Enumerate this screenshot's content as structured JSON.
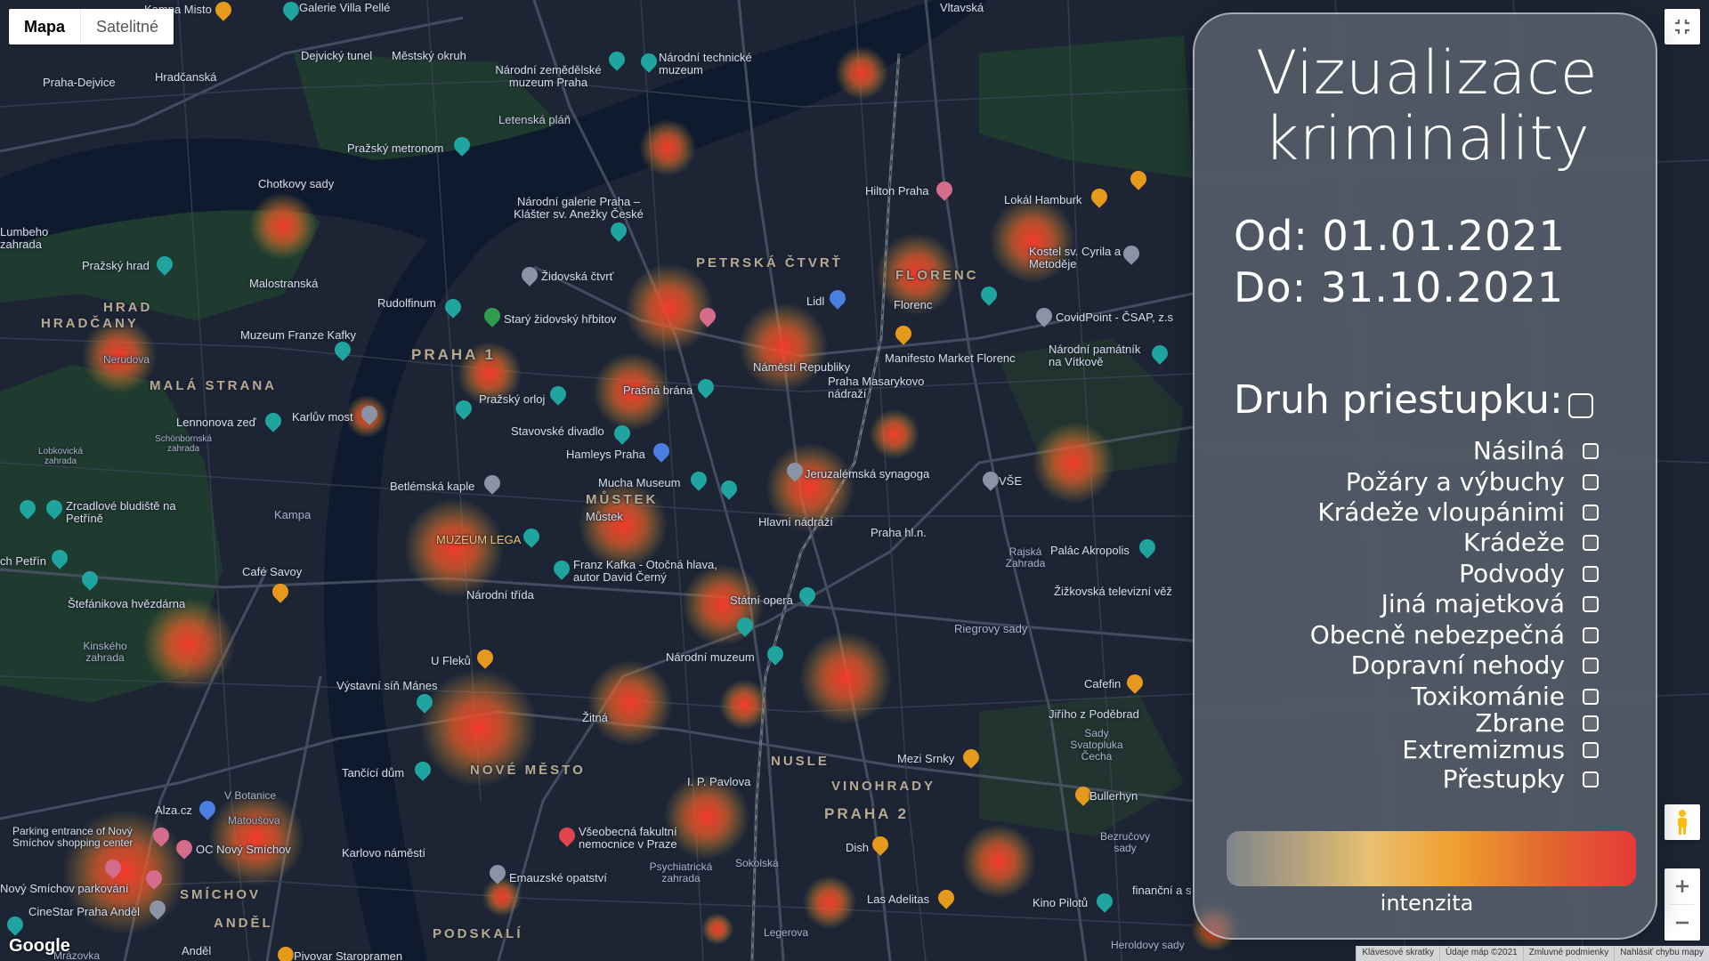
{
  "map": {
    "type_control": {
      "map": "Mapa",
      "satellite": "Satelitné"
    },
    "labels": {
      "galerie_villa_pelle": "Galerie Villa Pellé",
      "vltavska": "Vltavská",
      "dejvicky_tunel": "Dejvický tunel",
      "mestsky_okruh": "Městský okruh",
      "narodni_zemedelske": "Národní zemědělské muzeum Praha",
      "narodni_technicke": "Národní technické muzeum",
      "praha_dejvice": "Praha-Dejvice",
      "hradcanska": "Hradčanská",
      "letenska_plan": "Letenská pláň",
      "prazsky_metronom": "Pražský metronom",
      "chotkovy_sady": "Chotkovy sady",
      "narodni_galerie": "Národní galerie Praha – Klášter sv. Anežky České",
      "hilton": "Hilton Praha",
      "lokal_hamburk": "Lokál Hamburk",
      "kostel_cyrila": "Kostel sv. Cyrila a Metoděje",
      "lumbeho": "Lumbeho zahrada",
      "prazsky_hrad": "Pražský hrad",
      "hrad": "HRAD",
      "hradcany": "HRADČANY",
      "malostranska": "Malostranská",
      "rudolfinum": "Rudolfinum",
      "zidovska_ctvrt": "Židovská čtvrť",
      "petrska_ctvrt": "PETRSKÁ ČTVRŤ",
      "florenc_district": "FLORENC",
      "lidl": "Lidl",
      "florenc": "Florenc",
      "covidpoint": "CovidPoint - ČSAP, z.s",
      "stary_zidovsky": "Starý židovský hřbitov",
      "muzeum_kafky": "Muzeum Franze Kafky",
      "praha1": "PRAHA 1",
      "manifesto": "Manifesto Market Florenc",
      "narodni_pamatnik": "Národní památník na Vítkově",
      "namesti_republiky": "Náměstí Republiky",
      "masarykovo": "Praha Masarykovo nádraží",
      "mala_strana": "MALÁ STRANA",
      "prasna_brana": "Prašná brána",
      "prazsky_orloj": "Pražský orloj",
      "lennonova": "Lennonova zeď",
      "karluv_most": "Karlův most",
      "schonbornska": "Schönbornská zahrada",
      "lobkovicka": "Lobkovická zahrada",
      "stavovske": "Stavovské divadlo",
      "hamleys": "Hamleys Praha",
      "jeruzalemska": "Jeruzalémská synagoga",
      "vse": "VŠE",
      "betlemska": "Betlémská kaple",
      "mucha": "Mucha Museum",
      "mustek_district": "MŮSTEK",
      "mustek": "Můstek",
      "hlavni_nadrazi": "Hlavní nádraží",
      "praha_hln": "Praha hl.n.",
      "zrcadlove": "Zrcadlové bludiště na Petříně",
      "kampa": "Kampa",
      "muzeum_lega": "MUZEUM LEGA",
      "palac_akropolis": "Palác Akropolis",
      "rajska": "Rajská Zahrada",
      "petrin": "ch Petřín",
      "cafe_savoy": "Café Savoy",
      "kafka_hlava": "Franz Kafka - Otočná hlava, autor David Černý",
      "narodni_trida": "Národní třída",
      "statni_opera": "Státní opera",
      "zizkovska": "Žižkovská televizní věž",
      "stefanikova": "Štefánikova hvězdárna",
      "riegrovy": "Riegrovy sady",
      "kinskeho": "Kinského zahrada",
      "u_fleku": "U Fleků",
      "narodni_muzeum": "Národní muzeum",
      "cafefin": "Cafefin",
      "vystavni": "Výstavní síň Mánes",
      "jiriho": "Jiřího z Poděbrad",
      "sady_svatopluka": "Sady Svatopluka Čecha",
      "zitna": "Žitná",
      "mezi_srnky": "Mezi Srnky",
      "tancici_dum": "Tančící dům",
      "nove_mesto": "NOVÉ MĚSTO",
      "nusle": "NUSLE",
      "vinohrady": "VINOHRADY",
      "ip_pavlova": "I. P. Pavlova",
      "bullerhyn": "Bullerhyn",
      "praha2": "PRAHA 2",
      "alza": "Alza.cz",
      "v_botanice": "V Botanice",
      "matousova": "Matoušova",
      "parking_novy_smichov": "Parking entrance of Nový Smíchov shopping center",
      "oc_novy_smichov": "OC Nový Smíchov",
      "vseobecna": "Všeobecná fakultní nemocnice v Praze",
      "dish": "Dish",
      "bezrucovy": "Bezručovy sady",
      "karlovo": "Karlovo náměstí",
      "smichov": "SMÍCHOV",
      "emauzske": "Emauzské opatství",
      "psychiatricka": "Psychiatrická zahrada",
      "las_adelitas": "Las Adelitas",
      "kino_pilotu": "Kino Pilotů",
      "novy_smichov_parkovani": "Nový Smíchov parkování",
      "cinestar": "CineStar Praha Anděl",
      "andel_district": "ANDĚL",
      "podskali": "PODSKALÍ",
      "andel": "Anděl",
      "pivovar": "Pivovar Staropramen",
      "mrazovka": "Mrázovka",
      "sokolska": "Sokolská",
      "legerova": "Legerova",
      "heroldovy": "Heroldovy sady",
      "financni": "finanční a s",
      "nerudova": "Nerudova",
      "kampa_misto": "Kampa Misto"
    }
  },
  "panel": {
    "title_line1": "Vizualizace",
    "title_line2": "kriminality",
    "from": "Od: 01.01.2021",
    "to": "Do: 31.10.2021",
    "type_heading": "Druh priestupku:",
    "crime_types": [
      "Násilná",
      "Požáry a výbuchy",
      "Krádeže vloupánimi",
      "Krádeže",
      "Podvody",
      "Jiná majetková",
      "Obecně nebezpečná",
      "Dopravní nehody",
      "Toxikománie",
      "Zbrane",
      "Extremizmus",
      "Přestupky"
    ],
    "legend_label": "intenzita"
  },
  "footer": {
    "google": "Google",
    "shortcuts": "Klávesové skratky",
    "map_data": "Údaje máp ©2021",
    "terms": "Zmluvné podmienky",
    "report": "Nahlásiť chybu mapy"
  }
}
